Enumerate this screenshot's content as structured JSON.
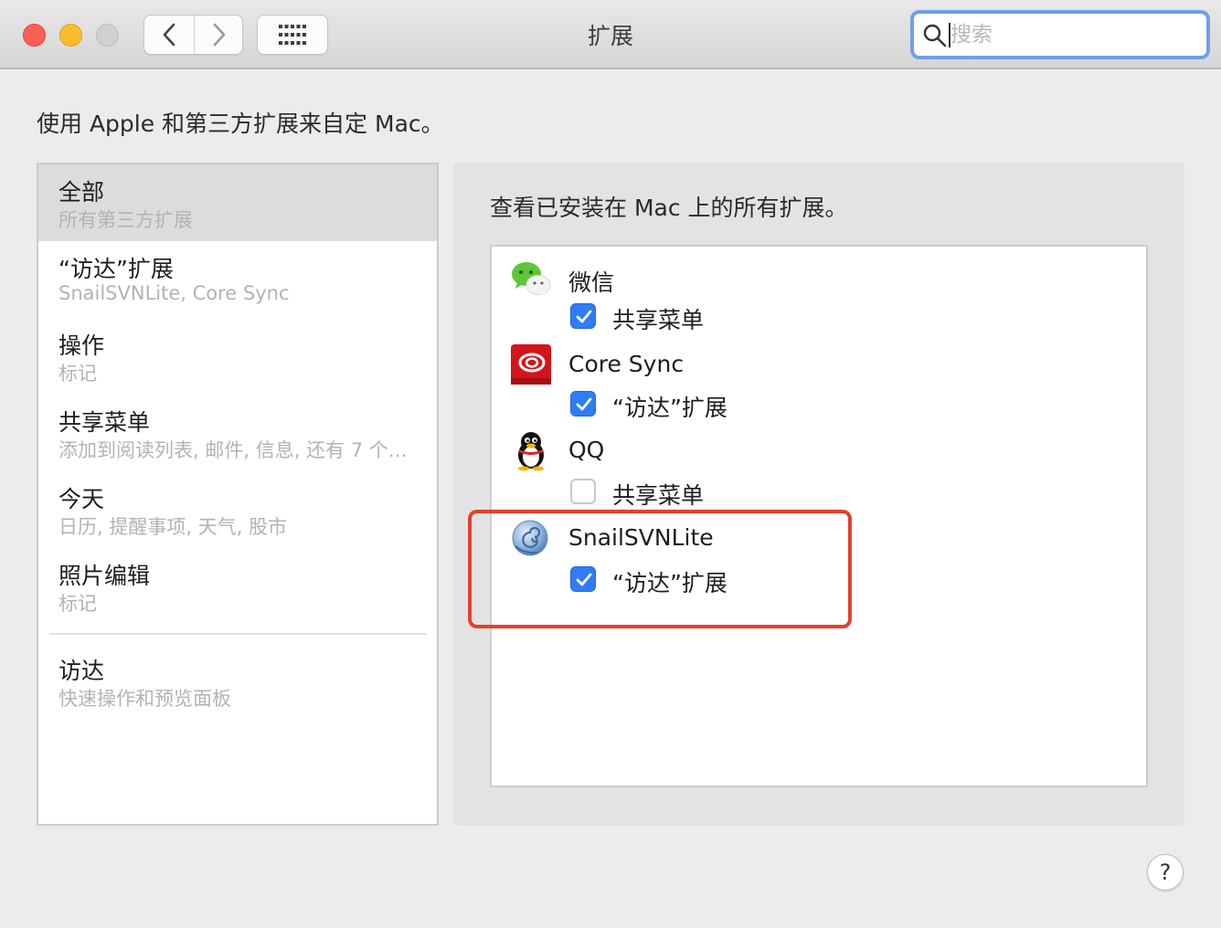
{
  "window": {
    "title": "扩展",
    "search_placeholder": "搜索"
  },
  "intro_text": "使用 Apple 和第三方扩展来自定 Mac。",
  "sidebar": {
    "items": [
      {
        "title": "全部",
        "subtitle": "所有第三方扩展",
        "selected": true
      },
      {
        "title": "“访达”扩展",
        "subtitle": "SnailSVNLite, Core Sync",
        "selected": false
      },
      {
        "title": "操作",
        "subtitle": "标记",
        "selected": false
      },
      {
        "title": "共享菜单",
        "subtitle": "添加到阅读列表, 邮件, 信息, 还有 7 个…",
        "selected": false
      },
      {
        "title": "今天",
        "subtitle": "日历, 提醒事项, 天气, 股市",
        "selected": false
      },
      {
        "title": "照片编辑",
        "subtitle": "标记",
        "selected": false
      },
      {
        "title": "访达",
        "subtitle": "快速操作和预览面板",
        "selected": false
      }
    ]
  },
  "panel": {
    "heading": "查看已安装在 Mac 上的所有扩展。",
    "apps": [
      {
        "name": "微信",
        "icon": "wechat-icon",
        "extension": {
          "label": "共享菜单",
          "checked": true
        }
      },
      {
        "name": "Core Sync",
        "icon": "adobe-creative-cloud-icon",
        "extension": {
          "label": "“访达”扩展",
          "checked": true
        }
      },
      {
        "name": "QQ",
        "icon": "qq-penguin-icon",
        "extension": {
          "label": "共享菜单",
          "checked": false
        }
      },
      {
        "name": "SnailSVNLite",
        "icon": "snail-shell-icon",
        "extension": {
          "label": "“访达”扩展",
          "checked": true
        }
      }
    ]
  },
  "help_label": "?",
  "colors": {
    "accent": "#2f7cf5",
    "highlight": "#e2402e",
    "search_focus": "#6fa0e8"
  }
}
